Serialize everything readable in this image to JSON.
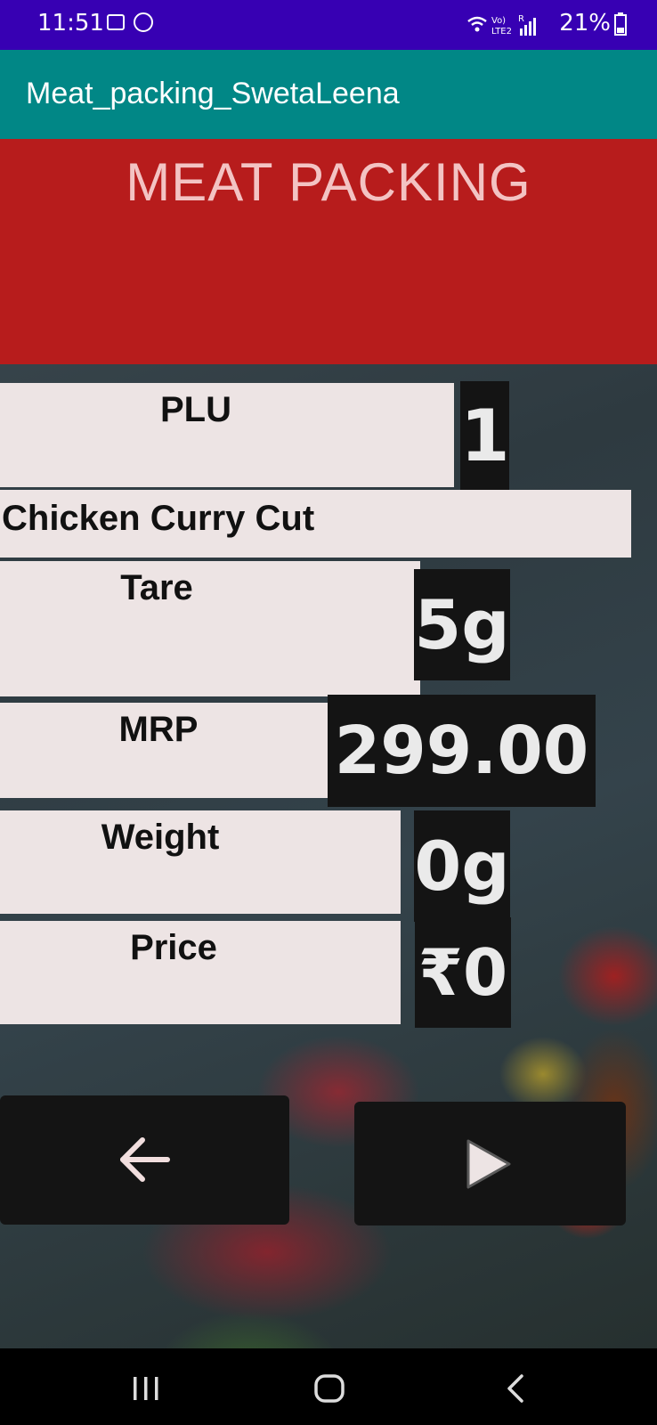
{
  "status_bar": {
    "time": "11:51",
    "battery_percent": "21%",
    "icons": [
      "gallery-icon",
      "whatsapp-icon",
      "wifi-icon",
      "volte-icon",
      "signal-icon",
      "battery-icon"
    ]
  },
  "app_bar": {
    "title": "Meat_packing_SwetaLeena"
  },
  "header": {
    "title": "MEAT PACKING"
  },
  "fields": {
    "plu": {
      "label": "PLU",
      "value": "1"
    },
    "product_name": "Chicken Curry Cut",
    "tare": {
      "label": "Tare",
      "value": "5g"
    },
    "mrp": {
      "label": "MRP",
      "value": "299.00"
    },
    "weight": {
      "label": "Weight",
      "value": "0g"
    },
    "price": {
      "label": "Price",
      "value": "₹0"
    }
  },
  "buttons": {
    "back_icon": "arrow-left-icon",
    "play_icon": "play-icon"
  },
  "nav_bar": {
    "icons": [
      "recents-icon",
      "home-icon",
      "back-icon"
    ]
  },
  "colors": {
    "status_bar": "#3700b3",
    "app_bar": "#018786",
    "header": "#b71c1c",
    "label_bg": "#ede4e4",
    "value_bg": "#141414"
  }
}
